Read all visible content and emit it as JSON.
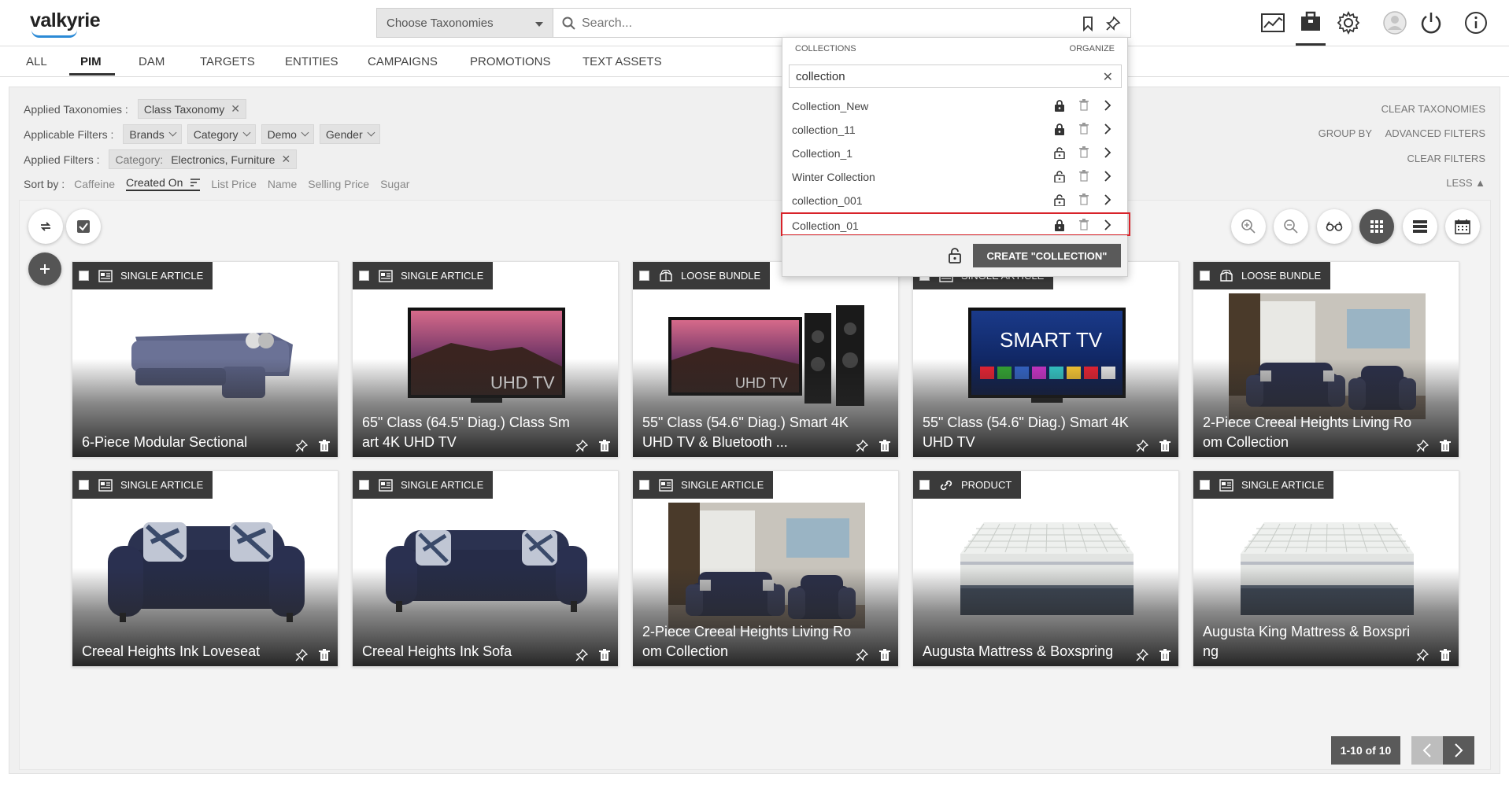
{
  "header": {
    "logo": "valkyrie",
    "taxonomy_select": "Choose Taxonomies",
    "search_placeholder": "Search..."
  },
  "tabs": [
    "ALL",
    "PIM",
    "DAM",
    "TARGETS",
    "ENTITIES",
    "CAMPAIGNS",
    "PROMOTIONS",
    "TEXT ASSETS"
  ],
  "active_tab": "PIM",
  "filters": {
    "applied_taxonomies_label": "Applied Taxonomies :",
    "applied_taxonomy_chip": "Class Taxonomy",
    "applicable_filters_label": "Applicable Filters :",
    "applicable_filters": [
      "Brands",
      "Category",
      "Demo",
      "Gender"
    ],
    "applied_filters_label": "Applied Filters :",
    "applied_filter_key": "Category:",
    "applied_filter_value": "Electronics, Furniture",
    "sort_label": "Sort by :",
    "sort_options": [
      "Caffeine",
      "Created On",
      "List Price",
      "Name",
      "Selling Price",
      "Sugar"
    ],
    "clear_taxonomies": "CLEAR TAXONOMIES",
    "group_by": "GROUP BY",
    "advanced_filters": "ADVANCED FILTERS",
    "clear_filters": "CLEAR FILTERS",
    "less": "LESS"
  },
  "collections_popup": {
    "header": "COLLECTIONS",
    "organize": "ORGANIZE",
    "search_value": "collection",
    "items": [
      {
        "label": "Collection_New",
        "locked": true
      },
      {
        "label": "collection_11",
        "locked": true
      },
      {
        "label": "Collection_1",
        "locked": false
      },
      {
        "label": "Winter Collection",
        "locked": false
      },
      {
        "label": "collection_001",
        "locked": false
      },
      {
        "label": "Collection_01",
        "locked": true,
        "selected": true
      }
    ],
    "create_button": "CREATE \"COLLECTION\""
  },
  "cards": [
    {
      "badge": "SINGLE ARTICLE",
      "title": "6-Piece Modular Sectional",
      "image": "sectional"
    },
    {
      "badge": "SINGLE ARTICLE",
      "title": "65\" Class (64.5\" Diag.) Class Smart 4K UHD TV",
      "image": "tv-uhd"
    },
    {
      "badge": "LOOSE BUNDLE",
      "title": "55\" Class (54.6\" Diag.) Smart 4K UHD TV & Bluetooth ...",
      "image": "tv-speakers"
    },
    {
      "badge": "SINGLE ARTICLE",
      "title": "55\" Class (54.6\" Diag.) Smart 4K UHD TV",
      "image": "tv-smart"
    },
    {
      "badge": "LOOSE BUNDLE",
      "title": "2-Piece Creeal Heights Living Room Collection",
      "image": "room"
    },
    {
      "badge": "SINGLE ARTICLE",
      "title": "Creeal Heights Ink Loveseat",
      "image": "loveseat"
    },
    {
      "badge": "SINGLE ARTICLE",
      "title": "Creeal Heights Ink Sofa",
      "image": "sofa"
    },
    {
      "badge": "SINGLE ARTICLE",
      "title": "2-Piece Creeal Heights Living Room Collection",
      "image": "room"
    },
    {
      "badge": "PRODUCT",
      "title": "Augusta Mattress & Boxspring",
      "image": "mattress"
    },
    {
      "badge": "SINGLE ARTICLE",
      "title": "Augusta King Mattress & Boxspring",
      "image": "mattress"
    }
  ],
  "pagination": {
    "label": "1-10 of 10"
  },
  "tv_labels": {
    "uhd": "UHD TV",
    "smart": "SMART TV"
  }
}
